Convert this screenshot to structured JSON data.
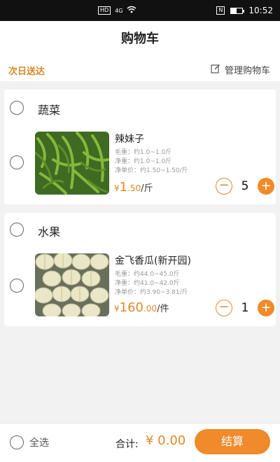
{
  "statusbar": {
    "hd": "HD",
    "net": "4G",
    "time": "10:52",
    "nfc": "N"
  },
  "header": {
    "title": "购物车"
  },
  "subbar": {
    "delivery": "次日送达",
    "manage": "管理购物车"
  },
  "groups": [
    {
      "category": "蔬菜",
      "item": {
        "name": "辣妹子",
        "gross_weight": "毛重：约1.0~1.0斤",
        "net_weight": "净重：约1.0~1.0斤",
        "net_unit_price": "净单价：约1.50~1.50/斤",
        "currency": "¥",
        "price_int": "1",
        "price_dec": ".50",
        "unit": "/斤",
        "qty": "5",
        "minus": "−",
        "plus": "+"
      }
    },
    {
      "category": "水果",
      "item": {
        "name": "金飞香瓜(新开园)",
        "gross_weight": "毛重：约44.0~45.0斤",
        "net_weight": "净重：约41.0~42.0斤",
        "net_unit_price": "净单价：约3.90~3.81/斤",
        "currency": "¥",
        "price_int": "160",
        "price_dec": ".00",
        "unit": "/件",
        "qty": "1",
        "minus": "−",
        "plus": "+"
      }
    }
  ],
  "footer": {
    "select_all": "全选",
    "total_label": "合计:",
    "total_value": "¥ 0.00",
    "checkout": "结算"
  },
  "colors": {
    "accent": "#f08a2a",
    "price": "#e08a2a",
    "delivery": "#d38a2b"
  }
}
